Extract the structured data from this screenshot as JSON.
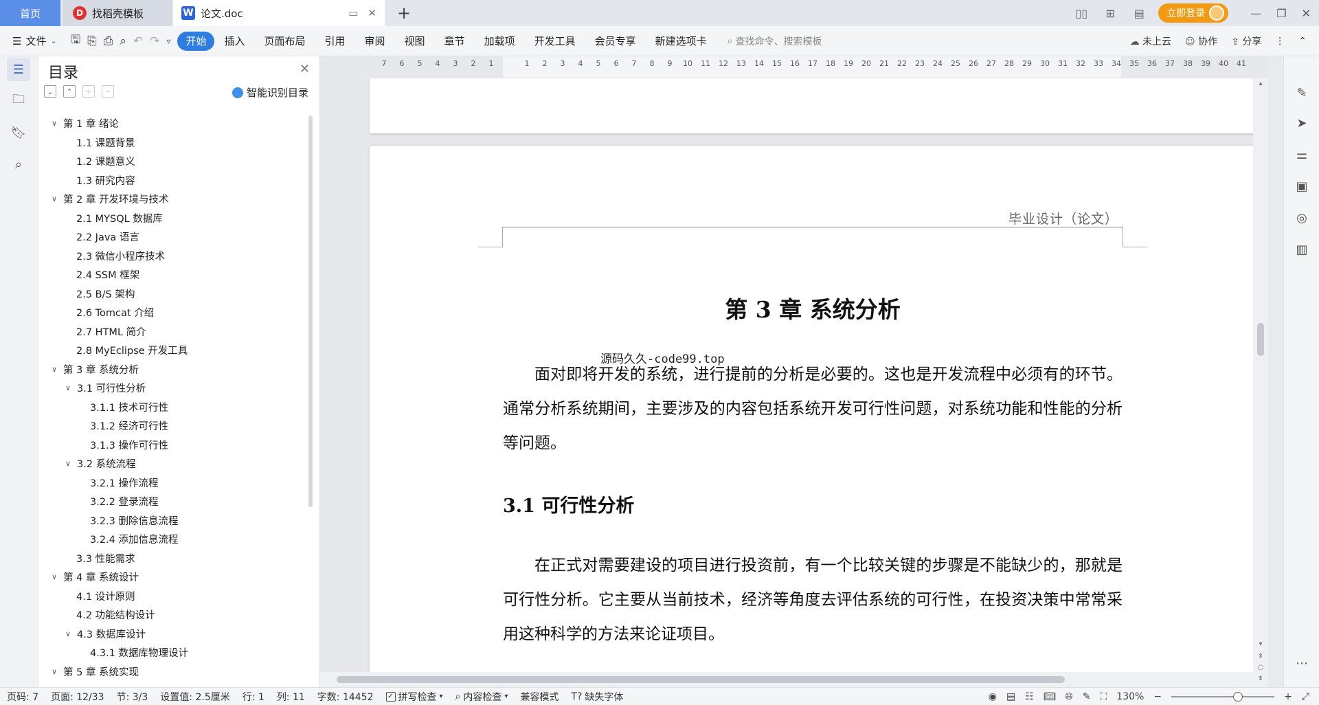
{
  "tabs": {
    "home": "首页",
    "templates": "找稻壳模板",
    "document": "论文.doc"
  },
  "topbar": {
    "login": "立即登录"
  },
  "ribbon": {
    "file": "文件",
    "tabs": [
      "开始",
      "插入",
      "页面布局",
      "引用",
      "审阅",
      "视图",
      "章节",
      "加载项",
      "开发工具",
      "会员专享",
      "新建选项卡"
    ],
    "search_placeholder": "查找命令、搜索模板",
    "cloud": "未上云",
    "collab": "协作",
    "share": "分享"
  },
  "toc": {
    "title": "目录",
    "smart": "智能识别目录",
    "items": [
      {
        "level": 1,
        "expanded": true,
        "text": "第 1 章  绪论"
      },
      {
        "level": 2,
        "text": "1.1  课题背景"
      },
      {
        "level": 2,
        "text": "1.2  课题意义"
      },
      {
        "level": 2,
        "text": "1.3  研究内容"
      },
      {
        "level": 1,
        "expanded": true,
        "text": "第 2 章  开发环境与技术"
      },
      {
        "level": 2,
        "text": "2.1  MYSQL 数据库"
      },
      {
        "level": 2,
        "text": "2.2  Java 语言"
      },
      {
        "level": 2,
        "text": "2.3  微信小程序技术"
      },
      {
        "level": 2,
        "text": "2.4  SSM 框架"
      },
      {
        "level": 2,
        "text": "2.5  B/S 架构"
      },
      {
        "level": 2,
        "text": "2.6  Tomcat  介绍"
      },
      {
        "level": 2,
        "text": "2.7  HTML 简介"
      },
      {
        "level": 2,
        "text": "2.8  MyEclipse 开发工具"
      },
      {
        "level": 1,
        "expanded": true,
        "text": "第 3 章  系统分析"
      },
      {
        "level": "2c",
        "expanded": true,
        "text": "3.1  可行性分析"
      },
      {
        "level": 3,
        "text": "3.1.1  技术可行性"
      },
      {
        "level": 3,
        "text": "3.1.2  经济可行性"
      },
      {
        "level": 3,
        "text": "3.1.3  操作可行性"
      },
      {
        "level": "2c",
        "expanded": true,
        "text": "3.2  系统流程"
      },
      {
        "level": 3,
        "text": "3.2.1  操作流程"
      },
      {
        "level": 3,
        "text": "3.2.2  登录流程"
      },
      {
        "level": 3,
        "text": "3.2.3  删除信息流程"
      },
      {
        "level": 3,
        "text": "3.2.4  添加信息流程"
      },
      {
        "level": 2,
        "text": "3.3  性能需求"
      },
      {
        "level": 1,
        "expanded": true,
        "text": "第 4 章  系统设计"
      },
      {
        "level": 2,
        "text": "4.1  设计原则"
      },
      {
        "level": 2,
        "text": "4.2  功能结构设计"
      },
      {
        "level": "2c",
        "expanded": true,
        "text": "4.3  数据库设计"
      },
      {
        "level": 3,
        "text": "4.3.1  数据库物理设计"
      },
      {
        "level": 1,
        "expanded": true,
        "text": "第 5 章  系统实现"
      }
    ]
  },
  "ruler": {
    "numbers": [
      "7",
      "6",
      "5",
      "4",
      "3",
      "2",
      "1",
      "",
      "1",
      "2",
      "3",
      "4",
      "5",
      "6",
      "7",
      "8",
      "9",
      "10",
      "11",
      "12",
      "13",
      "14",
      "15",
      "16",
      "17",
      "18",
      "19",
      "20",
      "21",
      "22",
      "23",
      "24",
      "25",
      "26",
      "27",
      "28",
      "29",
      "30",
      "31",
      "32",
      "33",
      "34",
      "35",
      "36",
      "37",
      "38",
      "39",
      "40",
      "41"
    ]
  },
  "document": {
    "header": "毕业设计（论文）",
    "chapter_title": "第 3 章  系统分析",
    "watermark": "源码久久-code99.top",
    "para1": "面对即将开发的系统，进行提前的分析是必要的。这也是开发流程中必须有的环节。通常分析系统期间，主要涉及的内容包括系统开发可行性问题，对系统功能和性能的分析等问题。",
    "section_title": "3.1  可行性分析",
    "para2": "在正式对需要建设的项目进行投资前，有一个比较关键的步骤是不能缺少的，那就是可行性分析。它主要从当前技术，经济等角度去评估系统的可行性，在投资决策中常常采用这种科学的方法来论证项目。"
  },
  "status": {
    "page": "页码: 7",
    "pages": "页面: 12/33",
    "section": "节: 3/3",
    "setting": "设置值: 2.5厘米",
    "row": "行: 1",
    "col": "列: 11",
    "words": "字数: 14452",
    "spell": "拼写检查",
    "content": "内容检查",
    "compat": "兼容模式",
    "font_missing": "缺失字体",
    "zoom": "130%"
  }
}
